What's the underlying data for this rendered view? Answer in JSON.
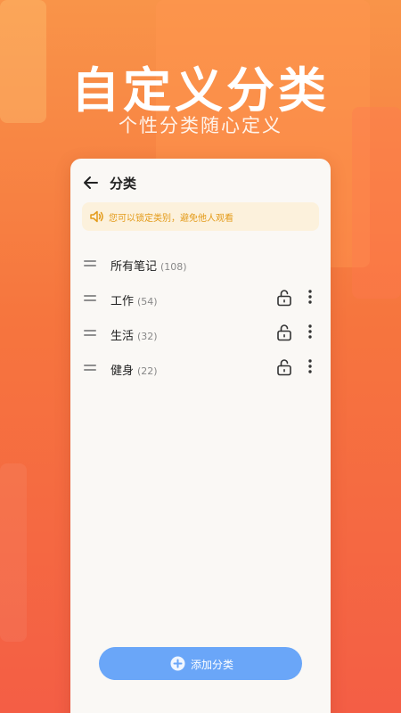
{
  "hero": {
    "title": "自定义分类",
    "subtitle": "个性分类随心定义"
  },
  "header": {
    "back_icon": "arrow-left-icon",
    "title": "分类"
  },
  "notice": {
    "icon": "speaker-icon",
    "text": "您可以锁定类别，避免他人观看",
    "color": "#e39a18"
  },
  "categories": [
    {
      "name": "所有笔记",
      "count": "(108)",
      "lockable": false
    },
    {
      "name": "工作",
      "count": "(54)",
      "lockable": true
    },
    {
      "name": "生活",
      "count": "(32)",
      "lockable": true
    },
    {
      "name": "健身",
      "count": "(22)",
      "lockable": true
    }
  ],
  "add_button": {
    "label": "添加分类",
    "icon": "plus-circle-icon",
    "color": "#6aa6f8"
  },
  "colors": {
    "gradient_top": "#f99449",
    "gradient_bottom": "#f45e45",
    "card_bg": "#faf8f5"
  }
}
